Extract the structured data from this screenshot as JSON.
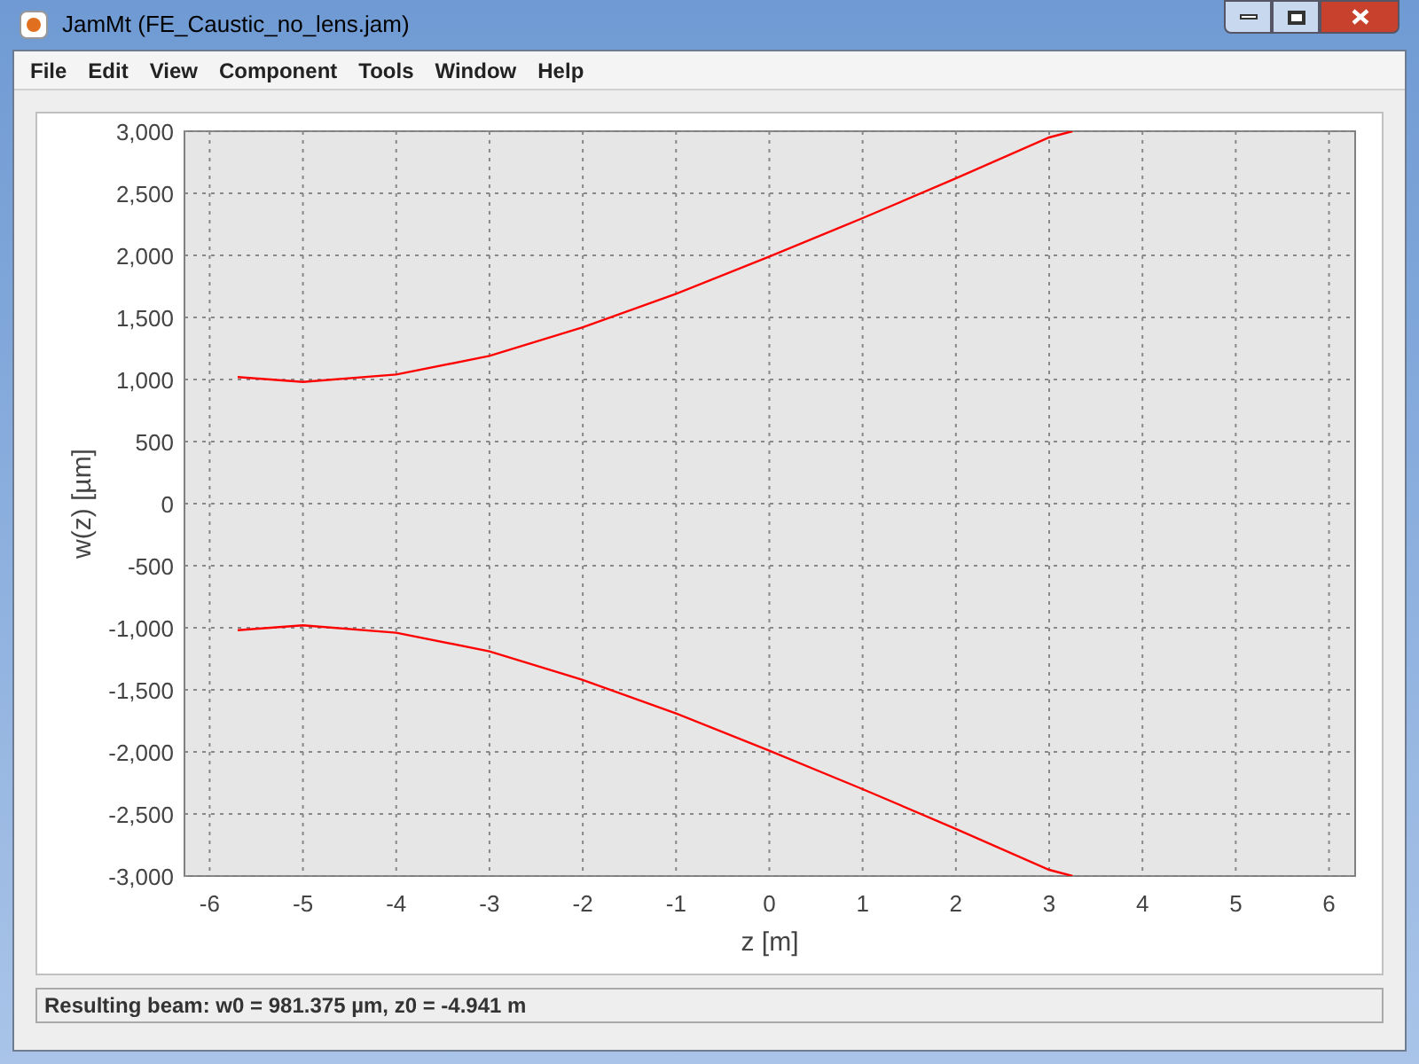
{
  "window": {
    "title": "JamMt (FE_Caustic_no_lens.jam)"
  },
  "menu": [
    "File",
    "Edit",
    "View",
    "Component",
    "Tools",
    "Window",
    "Help"
  ],
  "chart": {
    "chart_data": {
      "type": "line",
      "xlabel": "z [m]",
      "ylabel": "w(z) [µm]",
      "grid": true,
      "x": [
        -5.7,
        -5,
        -4,
        -3,
        -2,
        -1,
        0,
        1,
        2,
        3,
        3.25
      ],
      "series": [
        {
          "color": "#ff0000",
          "values": [
            1020,
            980,
            1040,
            1190,
            1420,
            1690,
            1990,
            2300,
            2620,
            2950,
            3000
          ]
        },
        {
          "color": "#ff0000",
          "values": [
            -1020,
            -980,
            -1040,
            -1190,
            -1420,
            -1690,
            -1990,
            -2300,
            -2620,
            -2950,
            -3000
          ]
        }
      ],
      "xlim": [
        -6.27,
        6.28
      ],
      "ylim": [
        -3000,
        3000
      ],
      "xticks": [
        {
          "value": -6,
          "label": "-6"
        },
        {
          "value": -5,
          "label": "-5"
        },
        {
          "value": -4,
          "label": "-4"
        },
        {
          "value": -3,
          "label": "-3"
        },
        {
          "value": -2,
          "label": "-2"
        },
        {
          "value": -1,
          "label": "-1"
        },
        {
          "value": 0,
          "label": "0"
        },
        {
          "value": 1,
          "label": "1"
        },
        {
          "value": 2,
          "label": "2"
        },
        {
          "value": 3,
          "label": "3"
        },
        {
          "value": 4,
          "label": "4"
        },
        {
          "value": 5,
          "label": "5"
        },
        {
          "value": 6,
          "label": "6"
        }
      ],
      "yticks": [
        {
          "value": -3000,
          "label": "-3,000"
        },
        {
          "value": -2500,
          "label": "-2,500"
        },
        {
          "value": -2000,
          "label": "-2,000"
        },
        {
          "value": -1500,
          "label": "-1,500"
        },
        {
          "value": -1000,
          "label": "-1,000"
        },
        {
          "value": -500,
          "label": "-500"
        },
        {
          "value": 0,
          "label": "0"
        },
        {
          "value": 500,
          "label": "500"
        },
        {
          "value": 1000,
          "label": "1,000"
        },
        {
          "value": 1500,
          "label": "1,500"
        },
        {
          "value": 2000,
          "label": "2,000"
        },
        {
          "value": 2500,
          "label": "2,500"
        },
        {
          "value": 3000,
          "label": "3,000"
        }
      ]
    }
  },
  "status_bar": "Resulting beam: w0 = 981.375 µm, z0 = -4.941 m"
}
